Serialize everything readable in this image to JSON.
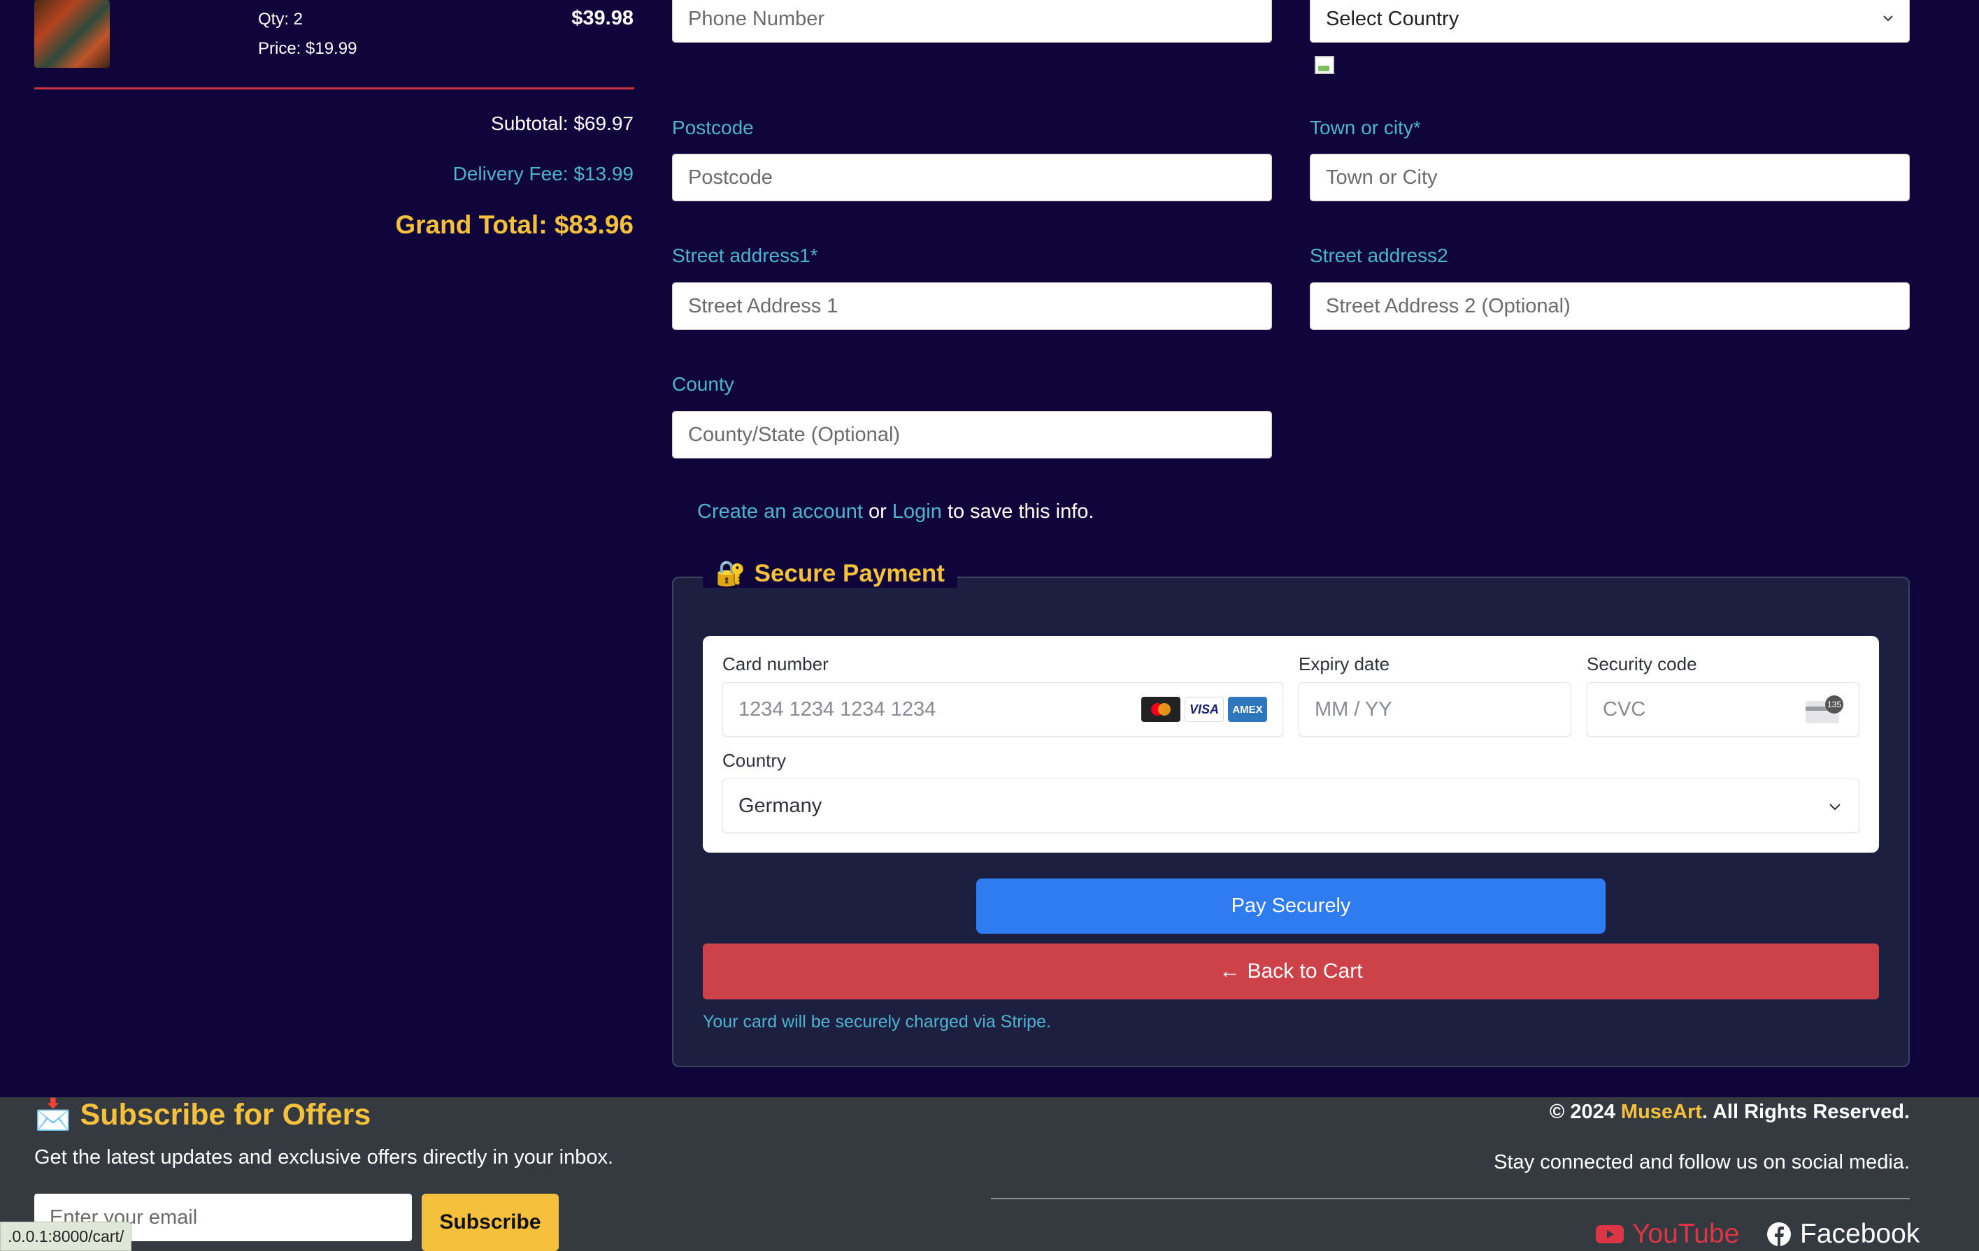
{
  "order": {
    "qty": "Qty: 2",
    "price": "Price: $19.99",
    "line_total": "$39.98",
    "subtotal": "Subtotal: $69.97",
    "delivery": "Delivery Fee: $13.99",
    "grand_total": "Grand Total: $83.96"
  },
  "address_form": {
    "phone_placeholder": "Phone Number",
    "country_select": "Select Country",
    "postcode_label": "Postcode",
    "postcode_placeholder": "Postcode",
    "town_label": "Town or city*",
    "town_placeholder": "Town or City",
    "street1_label": "Street address1*",
    "street1_placeholder": "Street Address 1",
    "street2_label": "Street address2",
    "street2_placeholder": "Street Address 2 (Optional)",
    "county_label": "County",
    "county_placeholder": "County/State (Optional)"
  },
  "account_prompt": {
    "create_link": "Create an account",
    "or": "or",
    "login_link": "Login",
    "suffix": "to save this info."
  },
  "payment": {
    "legend_icon": "🔐",
    "legend": "Secure Payment",
    "card_number_label": "Card number",
    "card_number_placeholder": "1234 1234 1234 1234",
    "expiry_label": "Expiry date",
    "expiry_placeholder": "MM / YY",
    "cvc_label": "Security code",
    "cvc_placeholder": "CVC",
    "cvc_badge": "135",
    "country_label": "Country",
    "country_value": "Germany",
    "card_brands": [
      "mastercard",
      "VISA",
      "AMEX"
    ],
    "pay_button": "Pay Securely",
    "back_arrow": "←",
    "back_button": "Back to Cart",
    "note": "Your card will be securely charged via Stripe."
  },
  "footer": {
    "subscribe_icon": "📩",
    "subscribe_title": "Subscribe for Offers",
    "subscribe_desc": "Get the latest updates and exclusive offers directly in your inbox.",
    "email_placeholder": "Enter your email",
    "subscribe_button": "Subscribe",
    "copyright_prefix": "© 2024",
    "brand": "MuseArt",
    "copyright_suffix": ". All Rights Reserved.",
    "stay_connected": "Stay connected and follow us on social media.",
    "youtube": "YouTube",
    "facebook": "Facebook"
  },
  "status_url": ".0.0.1:8000/cart/",
  "colors": {
    "background": "#10053a",
    "accent_yellow": "#f5c13c",
    "link_cyan": "#4fb3cf",
    "pay_blue": "#2f7bf0",
    "back_red": "#cd4149",
    "footer_bg": "#343a40"
  }
}
